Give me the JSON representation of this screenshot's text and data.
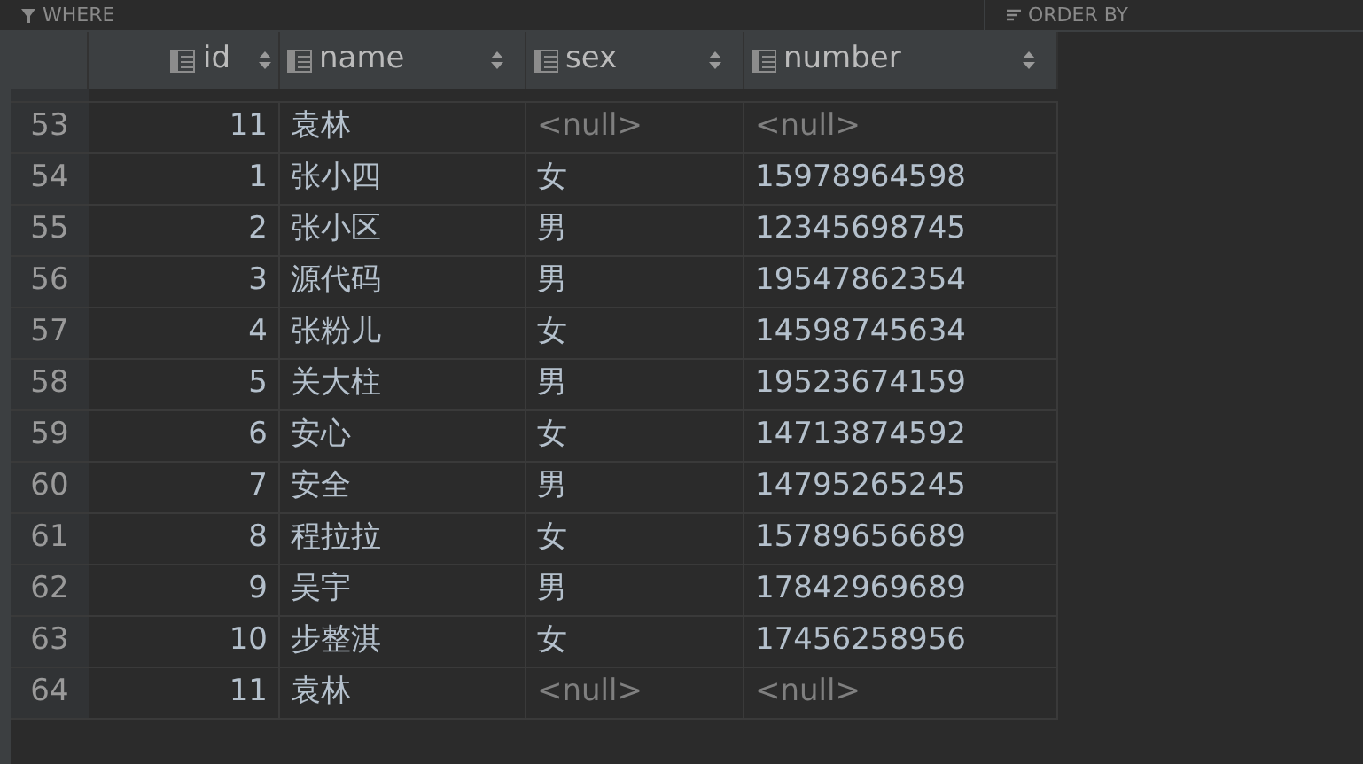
{
  "filter_bar": {
    "where": "WHERE",
    "order_by": "ORDER BY"
  },
  "table": {
    "columns": [
      {
        "label": "id",
        "kind": "numeric"
      },
      {
        "label": "name",
        "kind": "text"
      },
      {
        "label": "sex",
        "kind": "text"
      },
      {
        "label": "number",
        "kind": "text"
      }
    ],
    "rows": [
      {
        "row_number": "53",
        "cells": [
          {
            "text": "11",
            "null": false
          },
          {
            "text": "袁林",
            "null": false
          },
          {
            "text": "<null>",
            "null": true
          },
          {
            "text": "<null>",
            "null": true
          }
        ]
      },
      {
        "row_number": "54",
        "cells": [
          {
            "text": "1",
            "null": false
          },
          {
            "text": "张小四",
            "null": false
          },
          {
            "text": "女",
            "null": false
          },
          {
            "text": "15978964598",
            "null": false
          }
        ]
      },
      {
        "row_number": "55",
        "cells": [
          {
            "text": "2",
            "null": false
          },
          {
            "text": "张小区",
            "null": false
          },
          {
            "text": "男",
            "null": false
          },
          {
            "text": "12345698745",
            "null": false
          }
        ]
      },
      {
        "row_number": "56",
        "cells": [
          {
            "text": "3",
            "null": false
          },
          {
            "text": "源代码",
            "null": false
          },
          {
            "text": "男",
            "null": false
          },
          {
            "text": "19547862354",
            "null": false
          }
        ]
      },
      {
        "row_number": "57",
        "cells": [
          {
            "text": "4",
            "null": false
          },
          {
            "text": "张粉儿",
            "null": false
          },
          {
            "text": "女",
            "null": false
          },
          {
            "text": "14598745634",
            "null": false
          }
        ]
      },
      {
        "row_number": "58",
        "cells": [
          {
            "text": "5",
            "null": false
          },
          {
            "text": "关大柱",
            "null": false
          },
          {
            "text": "男",
            "null": false
          },
          {
            "text": "19523674159",
            "null": false
          }
        ]
      },
      {
        "row_number": "59",
        "cells": [
          {
            "text": "6",
            "null": false
          },
          {
            "text": "安心",
            "null": false
          },
          {
            "text": "女",
            "null": false
          },
          {
            "text": "14713874592",
            "null": false
          }
        ]
      },
      {
        "row_number": "60",
        "cells": [
          {
            "text": "7",
            "null": false
          },
          {
            "text": "安全",
            "null": false
          },
          {
            "text": "男",
            "null": false
          },
          {
            "text": "14795265245",
            "null": false
          }
        ]
      },
      {
        "row_number": "61",
        "cells": [
          {
            "text": "8",
            "null": false
          },
          {
            "text": "程拉拉",
            "null": false
          },
          {
            "text": "女",
            "null": false
          },
          {
            "text": "15789656689",
            "null": false
          }
        ]
      },
      {
        "row_number": "62",
        "cells": [
          {
            "text": "9",
            "null": false
          },
          {
            "text": "吴宇",
            "null": false
          },
          {
            "text": "男",
            "null": false
          },
          {
            "text": "17842969689",
            "null": false
          }
        ]
      },
      {
        "row_number": "63",
        "cells": [
          {
            "text": "10",
            "null": false
          },
          {
            "text": "步整淇",
            "null": false
          },
          {
            "text": "女",
            "null": false
          },
          {
            "text": "17456258956",
            "null": false
          }
        ]
      },
      {
        "row_number": "64",
        "cells": [
          {
            "text": "11",
            "null": false
          },
          {
            "text": "袁林",
            "null": false
          },
          {
            "text": "<null>",
            "null": true
          },
          {
            "text": "<null>",
            "null": true
          }
        ]
      }
    ]
  }
}
